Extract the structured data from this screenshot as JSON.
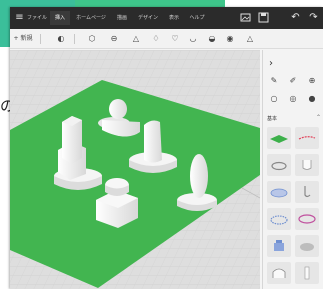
{
  "page": {
    "side_text": "の"
  },
  "ribbon": {
    "tabs": [
      {
        "label": "ファイル",
        "active": false
      },
      {
        "label": "挿入",
        "active": true
      },
      {
        "label": "ホームページ",
        "active": false
      },
      {
        "label": "描画",
        "active": false
      },
      {
        "label": "デザイン",
        "active": false
      },
      {
        "label": "表示",
        "active": false
      },
      {
        "label": "ヘルプ",
        "active": false
      }
    ],
    "icons": [
      "image-icon",
      "save-icon",
      "undo-icon",
      "redo-icon"
    ]
  },
  "toolbar": {
    "new_label": "+ 新規",
    "icons": [
      "dropper-icon",
      "cube-icon",
      "cylinder-icon",
      "cone-icon",
      "drop-icon",
      "heart-icon",
      "cup-icon",
      "cap-icon",
      "eye-icon",
      "pyramid-icon"
    ]
  },
  "side_panel": {
    "section_label": "基本",
    "tools": [
      "pencil-icon",
      "brush-icon",
      "globe-icon",
      "circle-icon",
      "target-icon",
      "sphere-icon"
    ]
  },
  "colors": {
    "platform": "#42b550",
    "grid": "#d9d9d9",
    "objects": "#ffffff",
    "tile_green": "#3cb04a",
    "tile_red": "#e2445c",
    "tile_blue": "#6f8fd0",
    "tile_pink": "#c0509e"
  }
}
